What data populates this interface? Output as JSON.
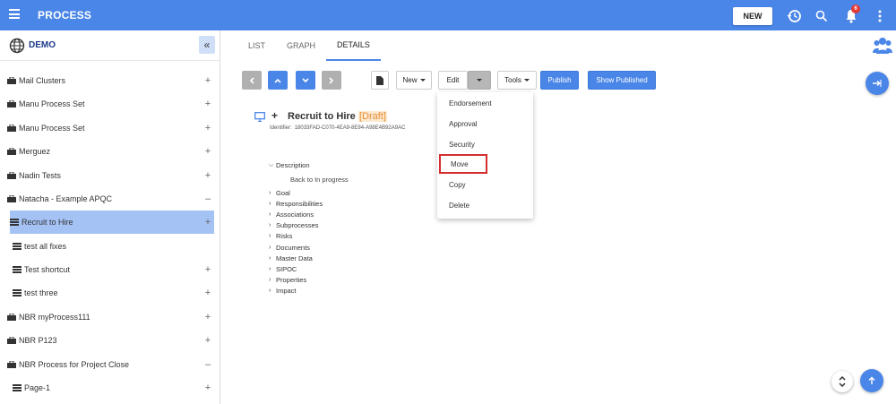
{
  "app": {
    "title": "PROCESS",
    "new_label": "NEW",
    "notification_count": "6"
  },
  "sidebar": {
    "title": "DEMO",
    "collapse_label": "«",
    "items": [
      {
        "label": "Mail Clusters",
        "control": "+"
      },
      {
        "label": "Manu Process Set",
        "control": "+"
      },
      {
        "label": "Manu Process Set",
        "control": "+"
      },
      {
        "label": "Merguez",
        "control": "+"
      },
      {
        "label": "Nadin Tests",
        "control": "+"
      },
      {
        "label": "Natacha - Example APQC",
        "control": "–"
      },
      {
        "label": "Recruit to Hire",
        "control": "+"
      },
      {
        "label": "test all fixes",
        "control": ""
      },
      {
        "label": "Test shortcut",
        "control": "+"
      },
      {
        "label": "test three",
        "control": "+"
      },
      {
        "label": "NBR myProcess111",
        "control": "+"
      },
      {
        "label": "NBR P123",
        "control": "+"
      },
      {
        "label": "NBR Process for Project Close",
        "control": "–"
      },
      {
        "label": "Page-1",
        "control": "+"
      }
    ]
  },
  "tabs": [
    {
      "label": "LIST"
    },
    {
      "label": "GRAPH"
    },
    {
      "label": "DETAILS"
    }
  ],
  "toolbar": {
    "new_label": "New",
    "edit_label": "Edit",
    "tools_label": "Tools",
    "publish_label": "Publish",
    "show_published_label": "Show Published"
  },
  "edit_menu": {
    "items": [
      {
        "label": "Endorsement"
      },
      {
        "label": "Approval"
      },
      {
        "label": "Security"
      },
      {
        "label": "Move"
      },
      {
        "label": "Copy"
      },
      {
        "label": "Delete"
      }
    ]
  },
  "details": {
    "title": "Recruit to Hire",
    "status": "[Draft]",
    "identifier_label": "Identifier:",
    "identifier_value": "18033FAD-C070-4EA9-8E94-A98E4B92A9AC",
    "back_link": "Back to In progress",
    "sections": [
      {
        "label": "Description",
        "expanded": true
      },
      {
        "label": "Goal"
      },
      {
        "label": "Responsibilities"
      },
      {
        "label": "Associations"
      },
      {
        "label": "Subprocesses"
      },
      {
        "label": "Risks"
      },
      {
        "label": "Documents"
      },
      {
        "label": "Master Data"
      },
      {
        "label": "SIPOC"
      },
      {
        "label": "Properties"
      },
      {
        "label": "Impact"
      }
    ]
  },
  "colors": {
    "brand": "#4a86e8",
    "selected_row": "#a4c2f4",
    "draft": "#e69138",
    "highlight_border": "#d32f2f"
  }
}
